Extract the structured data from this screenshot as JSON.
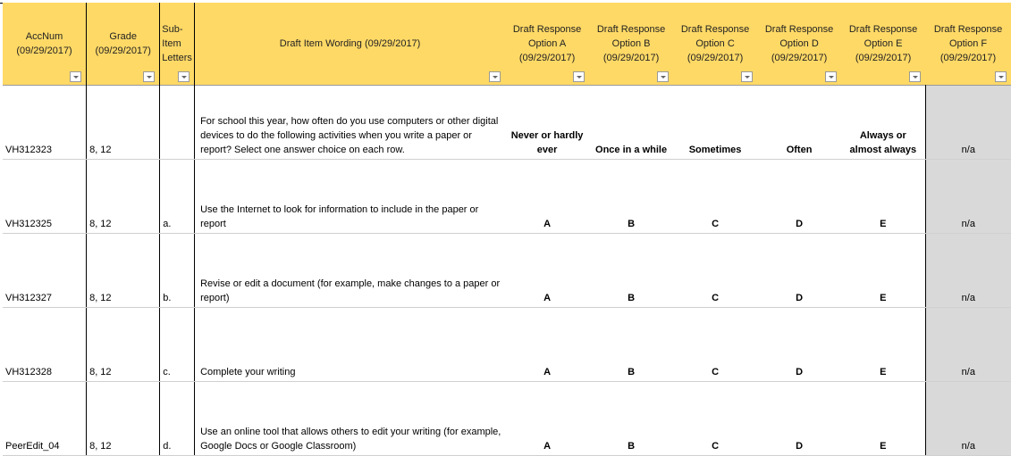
{
  "headers": [
    "AccNum (09/29/2017)",
    "Grade (09/29/2017)",
    "Sub-Item Letters",
    "Draft Item Wording (09/29/2017)",
    "Draft Response Option A (09/29/2017)",
    "Draft Response Option B (09/29/2017)",
    "Draft Response Option C (09/29/2017)",
    "Draft Response Option D (09/29/2017)",
    "Draft Response Option E (09/29/2017)",
    "Draft Response Option F (09/29/2017)"
  ],
  "rows": [
    [
      "VH312323",
      "8, 12",
      "",
      "For school this year, how often do you use computers or other digital devices to do the following activities when you write a paper or report? Select one answer choice on each row.",
      "Never or hardly ever",
      "Once in a while",
      "Sometimes",
      "Often",
      "Always or almost always",
      "n/a"
    ],
    [
      "VH312325",
      "8, 12",
      "a.",
      "Use the Internet to look for information to include in the paper or report",
      "A",
      "B",
      "C",
      "D",
      "E",
      "n/a"
    ],
    [
      "VH312327",
      "8, 12",
      "b.",
      "Revise or edit a document (for example, make changes to a paper or report)",
      "A",
      "B",
      "C",
      "D",
      "E",
      "n/a"
    ],
    [
      "VH312328",
      "8, 12",
      "c.",
      "Complete your writing",
      "A",
      "B",
      "C",
      "D",
      "E",
      "n/a"
    ],
    [
      "PeerEdit_04",
      "8, 12",
      "d.",
      "Use an online tool that allows others to edit your writing (for example, Google Docs or Google Classroom)",
      "A",
      "B",
      "C",
      "D",
      "E",
      "n/a"
    ]
  ]
}
